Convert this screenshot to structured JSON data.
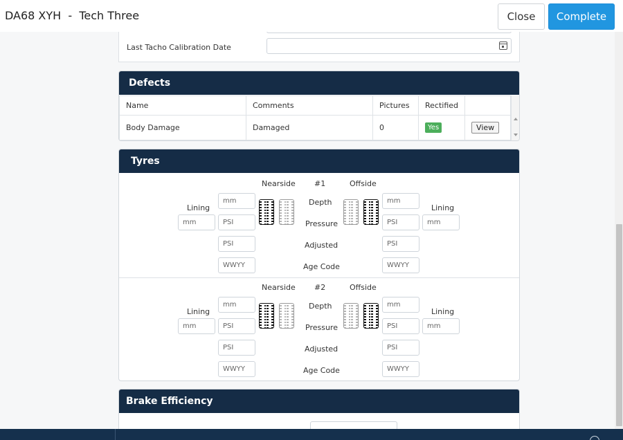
{
  "header": {
    "title": "DA68 XYH  -  Tech Three",
    "close_label": "Close",
    "complete_label": "Complete"
  },
  "vehicle_form": {
    "tacho_label": "Last Tacho Calibration Date",
    "tacho_value": "",
    "calendar_icon": "calendar-icon"
  },
  "defects": {
    "title": "Defects",
    "columns": [
      "Name",
      "Comments",
      "Pictures",
      "Rectified"
    ],
    "rows": [
      {
        "name": "Body Damage",
        "comments": "Damaged",
        "pictures": "0",
        "rectified": "Yes",
        "view_label": "View"
      }
    ],
    "colors": {
      "rectified_yes": "#4cae5b"
    }
  },
  "tyres": {
    "title": "Tyres",
    "axles": [
      {
        "number": "#1",
        "nearside_label": "Nearside",
        "offside_label": "Offside",
        "lining_label": "Lining",
        "row_labels": [
          "Depth",
          "Pressure",
          "Adjusted",
          "Age Code"
        ],
        "placeholders": {
          "depth": "mm",
          "pressure": "PSI",
          "adjusted": "PSI",
          "age": "WWYY",
          "lining": "mm"
        }
      },
      {
        "number": "#2",
        "nearside_label": "Nearside",
        "offside_label": "Offside",
        "lining_label": "Lining",
        "row_labels": [
          "Depth",
          "Pressure",
          "Adjusted",
          "Age Code"
        ],
        "placeholders": {
          "depth": "mm",
          "pressure": "PSI",
          "adjusted": "PSI",
          "age": "WWYY",
          "lining": "mm"
        }
      }
    ],
    "icons": {
      "tyre": "tyre-icon"
    }
  },
  "brake": {
    "title": "Brake Efficiency"
  },
  "colors": {
    "panel_header": "#152c46",
    "primary": "#2196e0",
    "footer": "#15304d"
  }
}
